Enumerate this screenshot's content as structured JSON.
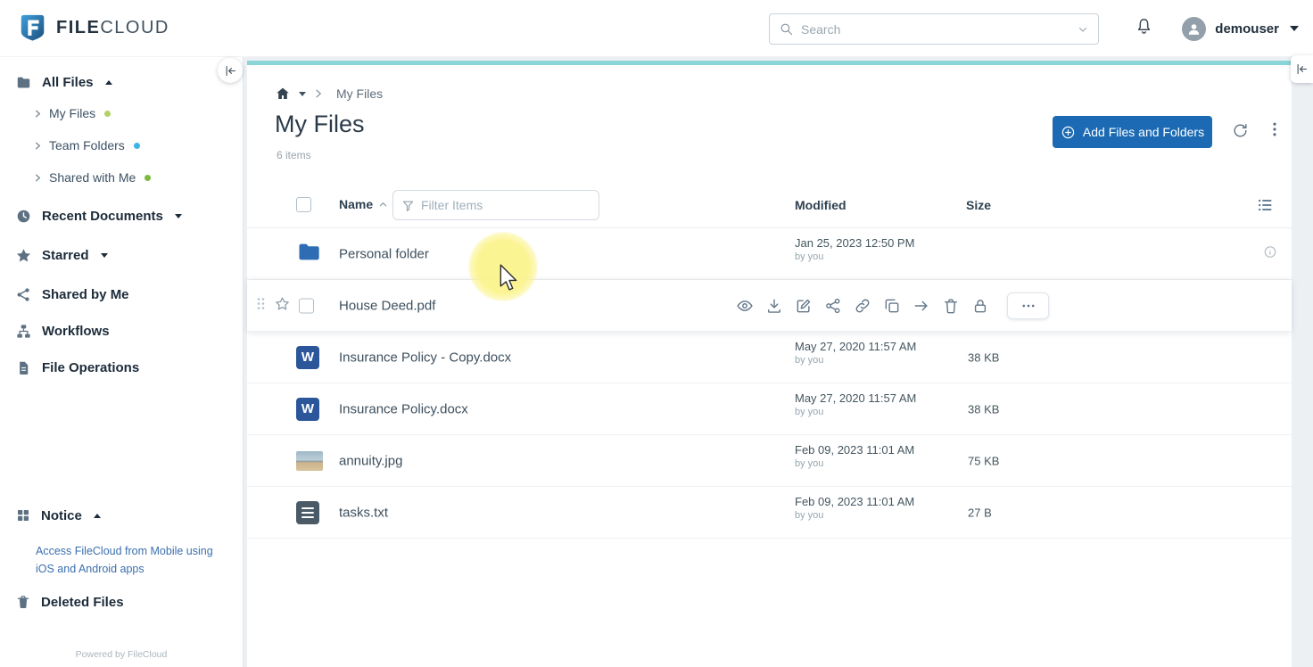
{
  "colors": {
    "brand_blue": "#1b6ab3",
    "accent_teal": "#8ad5d7",
    "folder_blue": "#2e6db4",
    "word_blue": "#2b579a",
    "dot_my_files": "#b1d267",
    "dot_team_folders": "#3cb4e5",
    "dot_shared_with_me": "#7cb93e",
    "highlight_yellow": "#fbf389",
    "notice_text_blue": "#3b6fae"
  },
  "header": {
    "brand": {
      "file": "FILE",
      "cloud": "CLOUD"
    },
    "search_placeholder": "Search",
    "username": "demouser"
  },
  "sidebar": {
    "all_files_label": "All Files",
    "tree": [
      {
        "label": "My Files"
      },
      {
        "label": "Team Folders"
      },
      {
        "label": "Shared with Me"
      }
    ],
    "items": [
      {
        "label": "Recent Documents"
      },
      {
        "label": "Starred"
      },
      {
        "label": "Shared by Me"
      },
      {
        "label": "Workflows"
      },
      {
        "label": "File Operations"
      }
    ],
    "notice_label": "Notice",
    "notice_text": "Access FileCloud from Mobile using iOS and Android apps",
    "deleted_files_label": "Deleted Files",
    "powered_by": "Powered by FileCloud"
  },
  "main": {
    "breadcrumb_current": "My Files",
    "title": "My Files",
    "item_count": "6 items",
    "add_button_label": "Add Files and Folders",
    "table": {
      "name_column": "Name",
      "modified_column": "Modified",
      "size_column": "Size",
      "filter_placeholder": "Filter Items",
      "rows": [
        {
          "name": "Personal folder",
          "type": "folder",
          "modified": "Jan 25, 2023 12:50 PM",
          "modified_by": "by you",
          "size": ""
        },
        {
          "name": "House Deed.pdf",
          "type": "pdf",
          "modified": "",
          "modified_by": "",
          "size": ""
        },
        {
          "name": "Insurance Policy - Copy.docx",
          "type": "word",
          "modified": "May 27, 2020 11:57 AM",
          "modified_by": "by you",
          "size": "38 KB"
        },
        {
          "name": "Insurance Policy.docx",
          "type": "word",
          "modified": "May 27, 2020 11:57 AM",
          "modified_by": "by you",
          "size": "38 KB"
        },
        {
          "name": "annuity.jpg",
          "type": "image",
          "modified": "Feb 09, 2023 11:01 AM",
          "modified_by": "by you",
          "size": "75 KB"
        },
        {
          "name": "tasks.txt",
          "type": "text",
          "modified": "Feb 09, 2023 11:01 AM",
          "modified_by": "by you",
          "size": "27 B"
        }
      ],
      "hover_actions": [
        "preview",
        "download",
        "edit",
        "share",
        "link",
        "copy",
        "move",
        "delete",
        "lock",
        "more"
      ]
    }
  }
}
